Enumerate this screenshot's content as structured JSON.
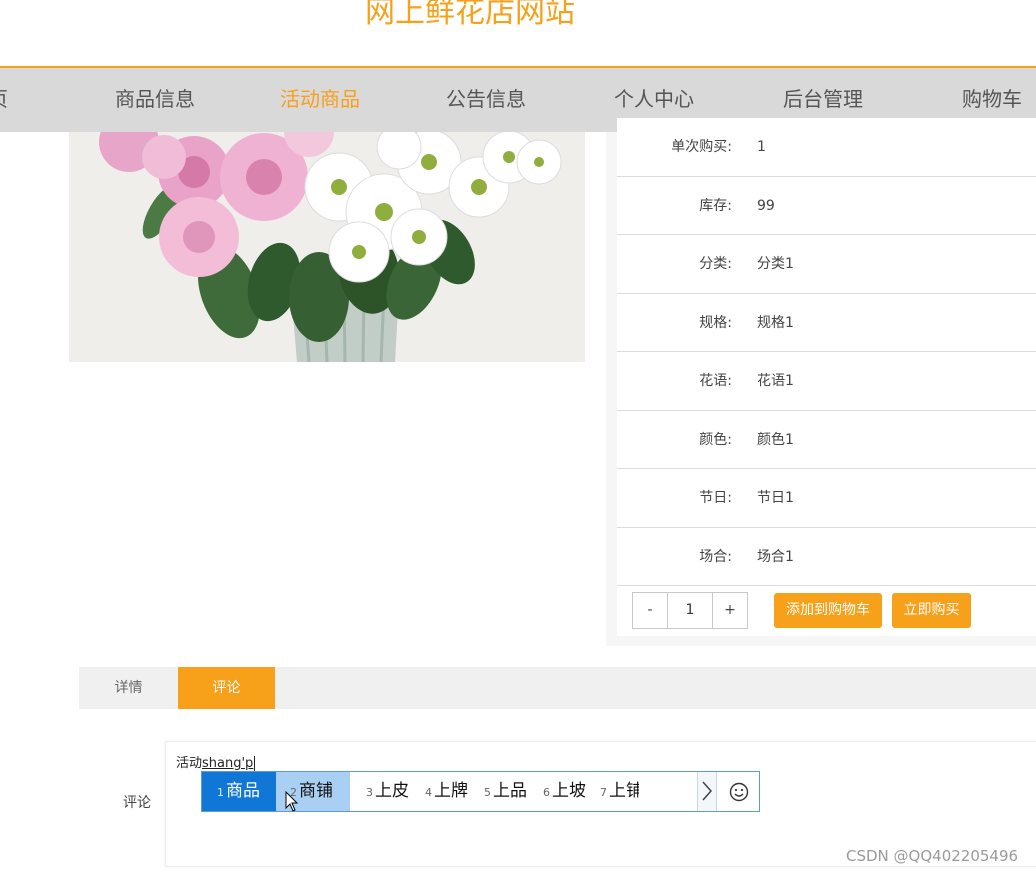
{
  "site_title": "网上鲜花店网站",
  "nav": {
    "items": [
      {
        "label": "页"
      },
      {
        "label": "商品信息"
      },
      {
        "label": "活动商品"
      },
      {
        "label": "公告信息"
      },
      {
        "label": "个人中心"
      },
      {
        "label": "后台管理"
      },
      {
        "label": "购物车"
      }
    ],
    "active": "活动商品"
  },
  "product_image": {
    "description_icon": "flower-bouquet-image"
  },
  "info_rows": [
    {
      "label": "单次购买:",
      "value": "1"
    },
    {
      "label": "库存:",
      "value": "99"
    },
    {
      "label": "分类:",
      "value": "分类1"
    },
    {
      "label": "规格:",
      "value": "规格1"
    },
    {
      "label": "花语:",
      "value": "花语1"
    },
    {
      "label": "颜色:",
      "value": "颜色1"
    },
    {
      "label": "节日:",
      "value": "节日1"
    },
    {
      "label": "场合:",
      "value": "场合1"
    }
  ],
  "stepper": {
    "minus": "-",
    "value": "1",
    "plus": "+"
  },
  "buttons": {
    "add_to_cart": "添加到购物车",
    "buy_now": "立即购买"
  },
  "tabs": {
    "details": "详情",
    "comments": "评论"
  },
  "comment": {
    "label": "评论",
    "typed_text": "活动",
    "composition": "shang'p"
  },
  "ime": {
    "candidates": [
      {
        "num": "1",
        "text": "商品"
      },
      {
        "num": "2",
        "text": "商铺"
      },
      {
        "num": "3",
        "text": "上皮"
      },
      {
        "num": "4",
        "text": "上牌"
      },
      {
        "num": "5",
        "text": "上品"
      },
      {
        "num": "6",
        "text": "上坡"
      },
      {
        "num": "7",
        "text": "上铺"
      }
    ],
    "next_icon": "chevron-right-icon",
    "emoji_icon": "smiley-icon"
  },
  "watermark": "CSDN @QQ402205496",
  "colors": {
    "accent": "#f7a01a",
    "nav_bg": "#d9d9d9",
    "ime_selected": "#1177d6",
    "ime_hover": "#a9d0f3"
  }
}
